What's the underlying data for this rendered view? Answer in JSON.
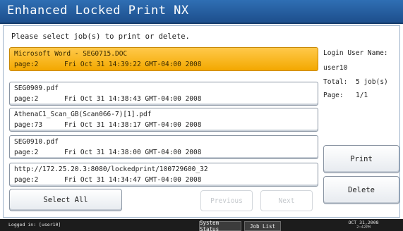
{
  "window": {
    "title": "Enhanced Locked Print NX"
  },
  "instruction": "Please select job(s) to print or delete.",
  "jobs": [
    {
      "name": "Microsoft Word - SEG0715.DOC",
      "pages": "page:2",
      "date": "Fri Oct 31 14:39:22 GMT-04:00 2008",
      "selected": true
    },
    {
      "name": "SEG0909.pdf",
      "pages": "page:2",
      "date": "Fri Oct 31 14:38:43 GMT-04:00 2008",
      "selected": false
    },
    {
      "name": "AthenaC1_Scan_GB(Scan066-7)[1].pdf",
      "pages": "page:73",
      "date": "Fri Oct 31 14:38:17 GMT-04:00 2008",
      "selected": false
    },
    {
      "name": "SEG0910.pdf",
      "pages": "page:2",
      "date": "Fri Oct 31 14:38:00 GMT-04:00 2008",
      "selected": false
    },
    {
      "name": "http://172.25.20.3:8080/lockedprint/100729600_32",
      "pages": "page:2",
      "date": "Fri Oct 31 14:34:47 GMT-04:00 2008",
      "selected": false
    }
  ],
  "info": {
    "login_label": "Login User Name:",
    "login_user": "user10",
    "total_label": "Total:",
    "total_value": "5 job(s)",
    "page_label": "Page:",
    "page_value": "1/1"
  },
  "buttons": {
    "print": "Print",
    "delete": "Delete",
    "select_all": "Select All",
    "previous": "Previous",
    "next": "Next"
  },
  "status_bar": {
    "logged_in": "Logged in: [user10]",
    "system_status": "System Status",
    "job_list": "Job List",
    "date": "OCT 31,2008",
    "time": "2:42PM"
  },
  "colors": {
    "title_bar": "#1d4f8c",
    "selected_row": "#f3a800",
    "status_bar": "#1c1c1c"
  }
}
